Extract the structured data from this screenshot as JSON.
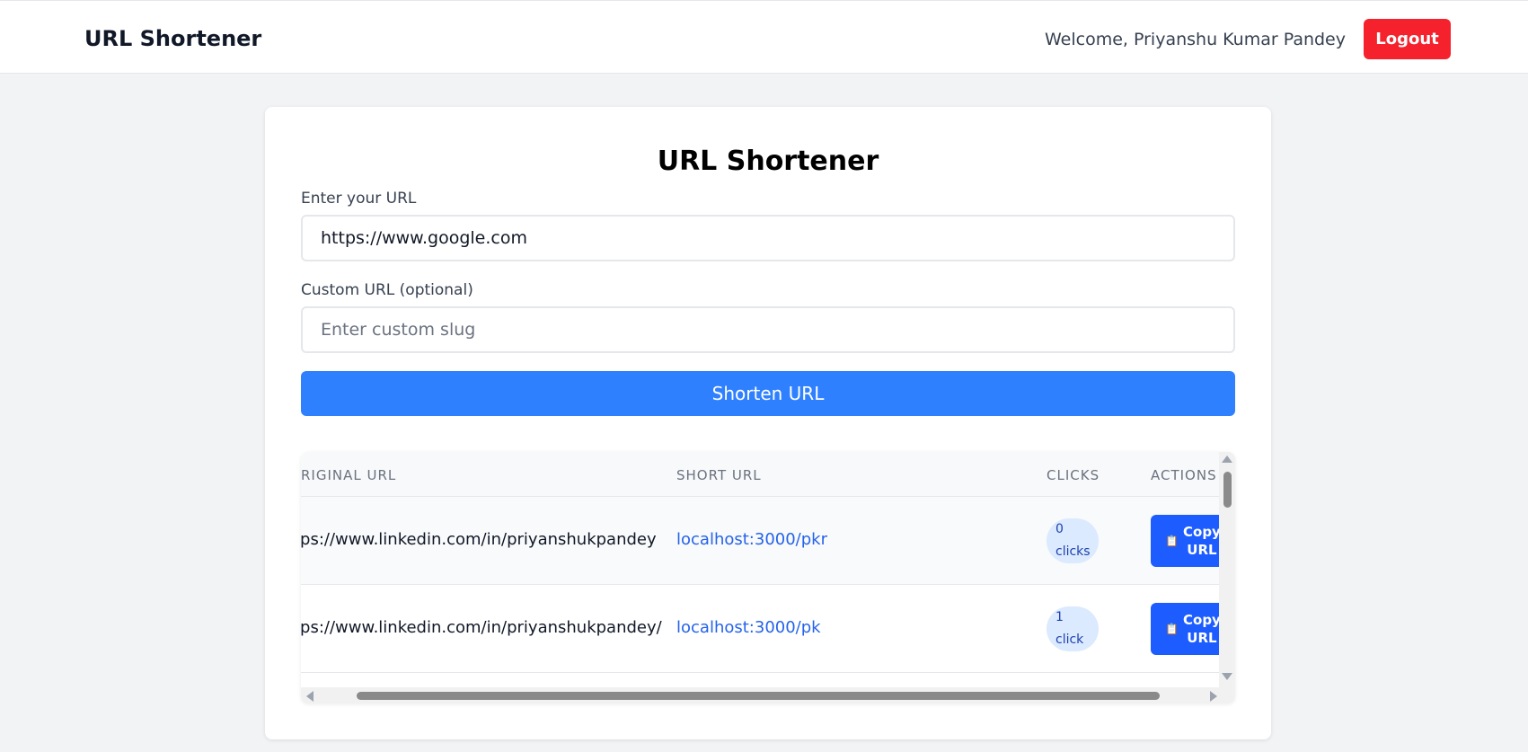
{
  "header": {
    "brand": "URL Shortener",
    "welcome": "Welcome, Priyanshu Kumar Pandey",
    "logout_label": "Logout"
  },
  "form": {
    "title": "URL Shortener",
    "url_label": "Enter your URL",
    "url_value": "https://www.google.com",
    "custom_label": "Custom URL (optional)",
    "custom_placeholder": "Enter custom slug",
    "submit_label": "Shorten URL"
  },
  "table": {
    "columns": [
      "RIGINAL URL",
      "SHORT URL",
      "CLICKS",
      "ACTIONS"
    ],
    "rows": [
      {
        "original": "tps://www.linkedin.com/in/priyanshukpandey",
        "short": "localhost:3000/pkr",
        "clicks_num": "0",
        "clicks_word": "clicks",
        "action_l1": "Copy",
        "action_l2": "URL"
      },
      {
        "original": "tps://www.linkedin.com/in/priyanshukpandey/",
        "short": "localhost:3000/pk",
        "clicks_num": "1",
        "clicks_word": "click",
        "action_l1": "Copy",
        "action_l2": "URL"
      }
    ]
  },
  "icons": {
    "copy": "clipboard-icon"
  },
  "colors": {
    "logout": "#f5222d",
    "primary": "#2f80ff",
    "copy_button": "#1d5cff",
    "link": "#2563eb",
    "badge_bg": "#dbeafe"
  }
}
